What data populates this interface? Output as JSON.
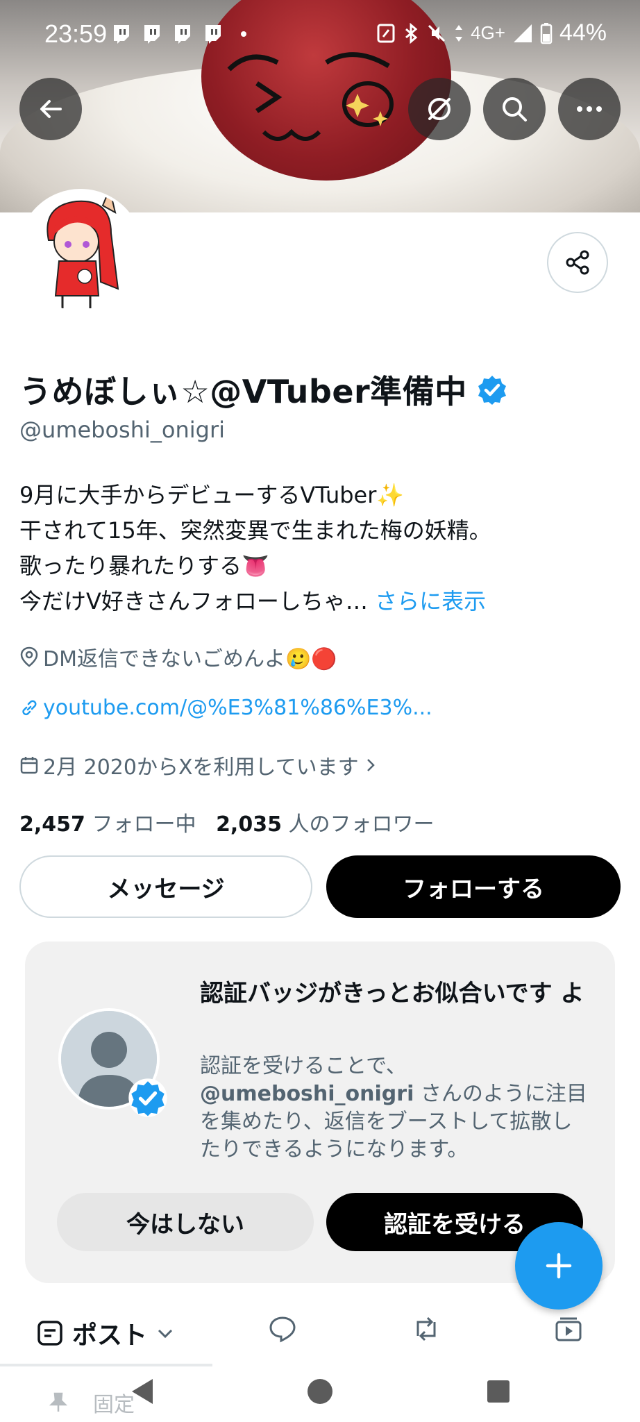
{
  "status_bar": {
    "time": "23:59",
    "network": "4G+",
    "battery": "44%"
  },
  "header": {
    "back_icon": "arrow-left-icon",
    "grok_icon": "slash-circle-icon",
    "search_icon": "search-icon",
    "more_icon": "more-horizontal-icon"
  },
  "profile": {
    "display_name": "うめぼしぃ☆@VTuber準備中",
    "handle": "@umeboshi_onigri",
    "verified_color": "#1d9bf0",
    "bio_lines": [
      "9月に大手からデビューするVTuber✨",
      "干されて15年、突然変異で生まれた梅の妖精。",
      "歌ったり暴れたりする👅"
    ],
    "bio_last_line": "今だけV好きさんフォローしちゃ…",
    "show_more": "さらに表示",
    "location": "DM返信できないごめんよ🥲🔴",
    "website": "youtube.com/@%E3%81%86%E3%...",
    "joined": "2月 2020からXを利用しています",
    "following_count": "2,457",
    "following_label": "フォロー中",
    "followers_count": "2,035",
    "followers_label": "人のフォロワー",
    "message_button": "メッセージ",
    "follow_button": "フォローする"
  },
  "verify_card": {
    "title": "認証バッジがきっとお似合いです よ",
    "body_prefix": "認証を受けることで、",
    "body_handle": "@umeboshi_onigri",
    "body_suffix": " さんのように注目を集めたり、返信をブーストして拡散したりできるようになります。",
    "dismiss_button": "今はしない",
    "verify_button": "認証を受ける"
  },
  "tabs": {
    "posts_label": "ポスト"
  },
  "pinned": {
    "label": "固定"
  },
  "colors": {
    "accent": "#1d9bf0",
    "text": "#0f1419",
    "muted": "#536471"
  }
}
